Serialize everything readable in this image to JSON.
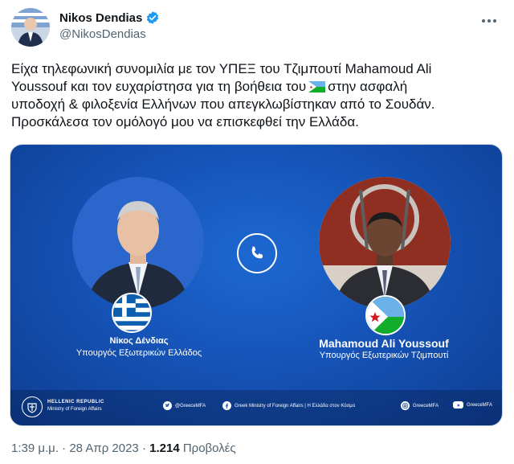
{
  "author": {
    "name": "Nikos Dendias",
    "handle": "@NikosDendias"
  },
  "tweet": {
    "line1": "Είχα τηλεφωνική συνομιλία με τον ΥΠΕΞ του Τζιμπουτί Mahamoud Ali",
    "line2a": "Youssouf και τον ευχαρίστησα για τη βοήθεια του",
    "line2b": "στην ασφαλή",
    "line3": "υποδοχή & φιλοξενία Ελλήνων που απεγκλωβίστηκαν από το Σουδάν.",
    "line4": "Προσκάλεσα τον ομόλογό μου να επισκεφθεί την Ελλάδα.",
    "inline_flag": "djibouti-flag-emoji"
  },
  "card": {
    "left_name": "Νίκος Δένδιας",
    "left_title": "Υπουργός Εξωτερικών Ελλάδος",
    "right_name": "Mahamoud Ali Youssouf",
    "right_title": "Υπουργός Εξωτερικών Τζιμπουτί",
    "footer": {
      "org_line1": "HELLENIC REPUBLIC",
      "org_line2": "Ministry of Foreign Affairs",
      "twitter": "@GreeceMFA",
      "facebook": "Greek Ministry of Foreign Affairs | Η Ελλάδα στον Κόσμο",
      "instagram": "GreeceMFA",
      "youtube": "GreeceMFA"
    },
    "background_color": "#1656bb"
  },
  "meta": {
    "time": "1:39 μ.μ.",
    "separator": "·",
    "date": "28 Απρ 2023",
    "views_count": "1.214",
    "views_label": "Προβολές"
  },
  "colors": {
    "verified": "#1d9bf0",
    "secondary_text": "#536471"
  }
}
